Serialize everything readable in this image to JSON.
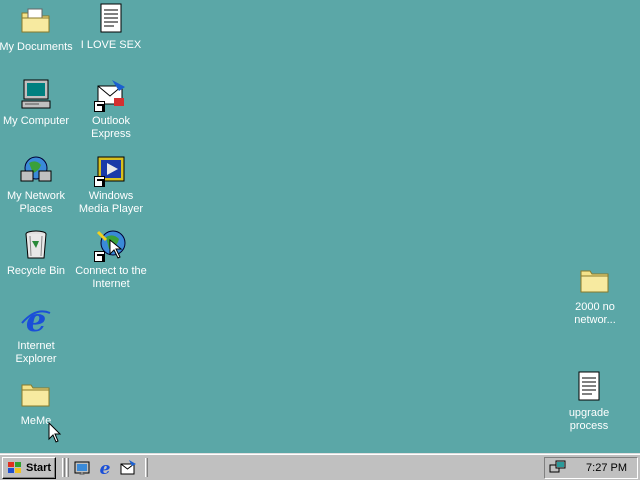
{
  "desktop": {
    "icons": [
      {
        "label": "My Documents",
        "icon": "folder-icon"
      },
      {
        "label": "I LOVE SEX",
        "icon": "text-document-icon"
      },
      {
        "label": "My Computer",
        "icon": "computer-icon"
      },
      {
        "label": "Outlook Express",
        "icon": "outlook-express-icon"
      },
      {
        "label": "My Network Places",
        "icon": "network-places-icon"
      },
      {
        "label": "Windows Media Player",
        "icon": "media-player-icon"
      },
      {
        "label": "Recycle Bin",
        "icon": "recycle-bin-icon"
      },
      {
        "label": "Connect to the Internet",
        "icon": "connect-internet-icon"
      },
      {
        "label": "Internet Explorer",
        "icon": "internet-explorer-icon"
      },
      {
        "label": "MeMe",
        "icon": "folder-icon"
      },
      {
        "label": "2000 no networ...",
        "icon": "folder-icon"
      },
      {
        "label": "upgrade process",
        "icon": "text-document-icon"
      }
    ]
  },
  "taskbar": {
    "start_label": "Start",
    "quick_launch": [
      "show-desktop-icon",
      "internet-explorer-icon",
      "outlook-express-icon"
    ],
    "tray_icon": "network-tray-icon",
    "clock": "7:27 PM"
  },
  "colors": {
    "desktop": "#5ba7a7",
    "taskbar": "#c0c0c0",
    "folder": "#f4e38a",
    "label_text": "#ffffff"
  }
}
